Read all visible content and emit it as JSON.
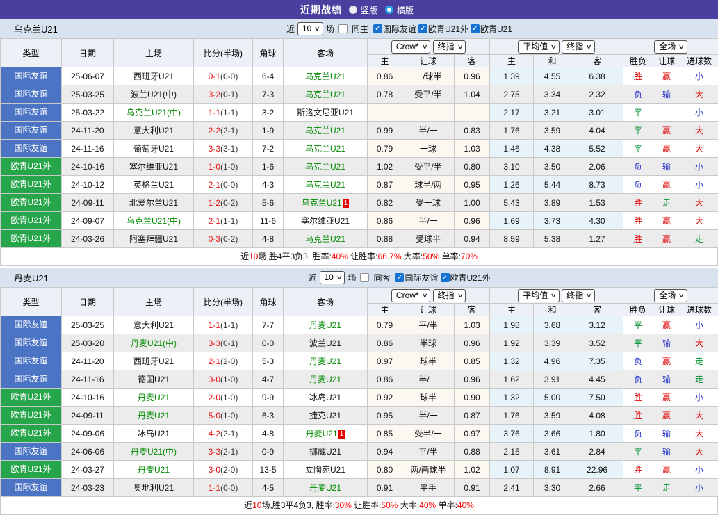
{
  "header": {
    "title": "近期战绩",
    "vertical_label": "竖版",
    "horizontal_label": "横版"
  },
  "table_header": {
    "col_type": "类型",
    "col_date": "日期",
    "col_home": "主场",
    "col_score": "比分(半场)",
    "col_corner": "角球",
    "col_away": "客场",
    "dd_crow": "Crow*",
    "dd_final1": "终指",
    "dd_avg": "平均值",
    "dd_final2": "终指",
    "dd_scope": "全场",
    "sub_home": "主",
    "sub_handicap": "让球",
    "sub_away": "客",
    "sub_avg_home": "主",
    "sub_avg_draw": "和",
    "sub_avg_away": "客",
    "col_result": "胜负",
    "col_handicap_result": "让球",
    "col_goals": "进球数"
  },
  "sections": [
    {
      "team": "乌克兰U21",
      "filter": {
        "near": "近",
        "count": "10",
        "games": "场",
        "same": "同主",
        "checks": [
          "国际友谊",
          "欧青U21外",
          "欧青U21"
        ]
      },
      "rows": [
        {
          "type": "国际友谊",
          "tc": "blue",
          "date": "25-06-07",
          "home": "西班牙U21",
          "hg": false,
          "score": "0-1",
          "half": "(0-0)",
          "corner": "6-4",
          "away": "乌克兰U21",
          "ag": true,
          "card": "",
          "oh": "0.86",
          "hcp": "一/球半",
          "oa": "0.96",
          "ah": "1.39",
          "ad": "4.55",
          "aa": "6.38",
          "res": "胜",
          "resc": "r",
          "hr": "赢",
          "hrc": "r",
          "gl": "小",
          "glc": "b"
        },
        {
          "type": "国际友谊",
          "tc": "blue",
          "date": "25-03-25",
          "home": "波兰U21(中)",
          "hg": false,
          "score": "3-2",
          "half": "(0-1)",
          "corner": "7-3",
          "away": "乌克兰U21",
          "ag": true,
          "card": "",
          "oh": "0.78",
          "hcp": "受平/半",
          "oa": "1.04",
          "ah": "2.75",
          "ad": "3.34",
          "aa": "2.32",
          "res": "负",
          "resc": "b",
          "hr": "输",
          "hrc": "b",
          "gl": "大",
          "glc": "r"
        },
        {
          "type": "国际友谊",
          "tc": "blue",
          "date": "25-03-22",
          "home": "乌克兰U21(中)",
          "hg": true,
          "score": "1-1",
          "half": "(1-1)",
          "corner": "3-2",
          "away": "斯洛文尼亚U21",
          "ag": false,
          "card": "",
          "oh": "",
          "hcp": "",
          "oa": "",
          "ah": "2.17",
          "ad": "3.21",
          "aa": "3.01",
          "res": "平",
          "resc": "g",
          "hr": "",
          "hrc": "",
          "gl": "小",
          "glc": "b"
        },
        {
          "type": "国际友谊",
          "tc": "blue",
          "date": "24-11-20",
          "home": "意大利U21",
          "hg": false,
          "score": "2-2",
          "half": "(2-1)",
          "corner": "1-9",
          "away": "乌克兰U21",
          "ag": true,
          "card": "",
          "oh": "0.99",
          "hcp": "半/一",
          "oa": "0.83",
          "ah": "1.76",
          "ad": "3.59",
          "aa": "4.04",
          "res": "平",
          "resc": "g",
          "hr": "赢",
          "hrc": "r",
          "gl": "大",
          "glc": "r"
        },
        {
          "type": "国际友谊",
          "tc": "blue",
          "date": "24-11-16",
          "home": "葡萄牙U21",
          "hg": false,
          "score": "3-3",
          "half": "(3-1)",
          "corner": "7-2",
          "away": "乌克兰U21",
          "ag": true,
          "card": "",
          "oh": "0.79",
          "hcp": "一球",
          "oa": "1.03",
          "ah": "1.46",
          "ad": "4.38",
          "aa": "5.52",
          "res": "平",
          "resc": "g",
          "hr": "赢",
          "hrc": "r",
          "gl": "大",
          "glc": "r"
        },
        {
          "type": "欧青U21外",
          "tc": "green",
          "date": "24-10-16",
          "home": "塞尔维亚U21",
          "hg": false,
          "score": "1-0",
          "half": "(1-0)",
          "corner": "1-6",
          "away": "乌克兰U21",
          "ag": true,
          "card": "",
          "oh": "1.02",
          "hcp": "受平/半",
          "oa": "0.80",
          "ah": "3.10",
          "ad": "3.50",
          "aa": "2.06",
          "res": "负",
          "resc": "b",
          "hr": "输",
          "hrc": "b",
          "gl": "小",
          "glc": "b"
        },
        {
          "type": "欧青U21外",
          "tc": "green",
          "date": "24-10-12",
          "home": "英格兰U21",
          "hg": false,
          "score": "2-1",
          "half": "(0-0)",
          "corner": "4-3",
          "away": "乌克兰U21",
          "ag": true,
          "card": "",
          "oh": "0.87",
          "hcp": "球半/两",
          "oa": "0.95",
          "ah": "1.26",
          "ad": "5.44",
          "aa": "8.73",
          "res": "负",
          "resc": "b",
          "hr": "赢",
          "hrc": "r",
          "gl": "小",
          "glc": "b"
        },
        {
          "type": "欧青U21外",
          "tc": "green",
          "date": "24-09-11",
          "home": "北爱尔兰U21",
          "hg": false,
          "score": "1-2",
          "half": "(0-2)",
          "corner": "5-6",
          "away": "乌克兰U21",
          "ag": true,
          "card": "1",
          "oh": "0.82",
          "hcp": "受一球",
          "oa": "1.00",
          "ah": "5.43",
          "ad": "3.89",
          "aa": "1.53",
          "res": "胜",
          "resc": "r",
          "hr": "走",
          "hrc": "g",
          "gl": "大",
          "glc": "r"
        },
        {
          "type": "欧青U21外",
          "tc": "green",
          "date": "24-09-07",
          "home": "乌克兰U21(中)",
          "hg": true,
          "score": "2-1",
          "half": "(1-1)",
          "corner": "11-6",
          "away": "塞尔维亚U21",
          "ag": false,
          "card": "",
          "oh": "0.86",
          "hcp": "半/一",
          "oa": "0.96",
          "ah": "1.69",
          "ad": "3.73",
          "aa": "4.30",
          "res": "胜",
          "resc": "r",
          "hr": "赢",
          "hrc": "r",
          "gl": "大",
          "glc": "r"
        },
        {
          "type": "欧青U21外",
          "tc": "green",
          "date": "24-03-26",
          "home": "阿塞拜疆U21",
          "hg": false,
          "score": "0-3",
          "half": "(0-2)",
          "corner": "4-8",
          "away": "乌克兰U21",
          "ag": true,
          "card": "",
          "oh": "0.88",
          "hcp": "受球半",
          "oa": "0.94",
          "ah": "8.59",
          "ad": "5.38",
          "aa": "1.27",
          "res": "胜",
          "resc": "r",
          "hr": "赢",
          "hrc": "r",
          "gl": "走",
          "glc": "g"
        }
      ],
      "summary": [
        {
          "t": "近"
        },
        {
          "t": "10",
          "r": true
        },
        {
          "t": "场,胜4平3负3, 胜率:"
        },
        {
          "t": "40%",
          "r": true
        },
        {
          "t": " 让胜率:"
        },
        {
          "t": "66.7%",
          "r": true
        },
        {
          "t": " 大率:"
        },
        {
          "t": "50%",
          "r": true
        },
        {
          "t": " 单率:"
        },
        {
          "t": "70%",
          "r": true
        }
      ]
    },
    {
      "team": "丹麦U21",
      "filter": {
        "near": "近",
        "count": "10",
        "games": "场",
        "same": "同客",
        "checks": [
          "国际友谊",
          "欧青U21外"
        ]
      },
      "rows": [
        {
          "type": "国际友谊",
          "tc": "blue",
          "date": "25-03-25",
          "home": "意大利U21",
          "hg": false,
          "score": "1-1",
          "half": "(1-1)",
          "corner": "7-7",
          "away": "丹麦U21",
          "ag": true,
          "card": "",
          "oh": "0.79",
          "hcp": "平/半",
          "oa": "1.03",
          "ah": "1.98",
          "ad": "3.68",
          "aa": "3.12",
          "res": "平",
          "resc": "g",
          "hr": "赢",
          "hrc": "r",
          "gl": "小",
          "glc": "b"
        },
        {
          "type": "国际友谊",
          "tc": "blue",
          "date": "25-03-20",
          "home": "丹麦U21(中)",
          "hg": true,
          "score": "3-3",
          "half": "(0-1)",
          "corner": "0-0",
          "away": "波兰U21",
          "ag": false,
          "card": "",
          "oh": "0.86",
          "hcp": "半球",
          "oa": "0.96",
          "ah": "1.92",
          "ad": "3.39",
          "aa": "3.52",
          "res": "平",
          "resc": "g",
          "hr": "输",
          "hrc": "b",
          "gl": "大",
          "glc": "r"
        },
        {
          "type": "国际友谊",
          "tc": "blue",
          "date": "24-11-20",
          "home": "西班牙U21",
          "hg": false,
          "score": "2-1",
          "half": "(2-0)",
          "corner": "5-3",
          "away": "丹麦U21",
          "ag": true,
          "card": "",
          "oh": "0.97",
          "hcp": "球半",
          "oa": "0.85",
          "ah": "1.32",
          "ad": "4.96",
          "aa": "7.35",
          "res": "负",
          "resc": "b",
          "hr": "赢",
          "hrc": "r",
          "gl": "走",
          "glc": "g"
        },
        {
          "type": "国际友谊",
          "tc": "blue",
          "date": "24-11-16",
          "home": "德国U21",
          "hg": false,
          "score": "3-0",
          "half": "(1-0)",
          "corner": "4-7",
          "away": "丹麦U21",
          "ag": true,
          "card": "",
          "oh": "0.86",
          "hcp": "半/一",
          "oa": "0.96",
          "ah": "1.62",
          "ad": "3.91",
          "aa": "4.45",
          "res": "负",
          "resc": "b",
          "hr": "输",
          "hrc": "b",
          "gl": "走",
          "glc": "g"
        },
        {
          "type": "欧青U21外",
          "tc": "green",
          "date": "24-10-16",
          "home": "丹麦U21",
          "hg": true,
          "score": "2-0",
          "half": "(1-0)",
          "corner": "9-9",
          "away": "冰岛U21",
          "ag": false,
          "card": "",
          "oh": "0.92",
          "hcp": "球半",
          "oa": "0.90",
          "ah": "1.32",
          "ad": "5.00",
          "aa": "7.50",
          "res": "胜",
          "resc": "r",
          "hr": "赢",
          "hrc": "r",
          "gl": "小",
          "glc": "b"
        },
        {
          "type": "欧青U21外",
          "tc": "green",
          "date": "24-09-11",
          "home": "丹麦U21",
          "hg": true,
          "score": "5-0",
          "half": "(1-0)",
          "corner": "6-3",
          "away": "捷克U21",
          "ag": false,
          "card": "",
          "oh": "0.95",
          "hcp": "半/一",
          "oa": "0.87",
          "ah": "1.76",
          "ad": "3.59",
          "aa": "4.08",
          "res": "胜",
          "resc": "r",
          "hr": "赢",
          "hrc": "r",
          "gl": "大",
          "glc": "r"
        },
        {
          "type": "欧青U21外",
          "tc": "green",
          "date": "24-09-06",
          "home": "冰岛U21",
          "hg": false,
          "score": "4-2",
          "half": "(2-1)",
          "corner": "4-8",
          "away": "丹麦U21",
          "ag": true,
          "card": "1",
          "oh": "0.85",
          "hcp": "受半/一",
          "oa": "0.97",
          "ah": "3.76",
          "ad": "3.66",
          "aa": "1.80",
          "res": "负",
          "resc": "b",
          "hr": "输",
          "hrc": "b",
          "gl": "大",
          "glc": "r"
        },
        {
          "type": "国际友谊",
          "tc": "blue",
          "date": "24-06-06",
          "home": "丹麦U21(中)",
          "hg": true,
          "score": "3-3",
          "half": "(2-1)",
          "corner": "0-9",
          "away": "挪威U21",
          "ag": false,
          "card": "",
          "oh": "0.94",
          "hcp": "平/半",
          "oa": "0.88",
          "ah": "2.15",
          "ad": "3.61",
          "aa": "2.84",
          "res": "平",
          "resc": "g",
          "hr": "输",
          "hrc": "b",
          "gl": "大",
          "glc": "r"
        },
        {
          "type": "欧青U21外",
          "tc": "green",
          "date": "24-03-27",
          "home": "丹麦U21",
          "hg": true,
          "score": "3-0",
          "half": "(2-0)",
          "corner": "13-5",
          "away": "立陶宛U21",
          "ag": false,
          "card": "",
          "oh": "0.80",
          "hcp": "两/两球半",
          "oa": "1.02",
          "ah": "1.07",
          "ad": "8.91",
          "aa": "22.96",
          "res": "胜",
          "resc": "r",
          "hr": "赢",
          "hrc": "r",
          "gl": "小",
          "glc": "b"
        },
        {
          "type": "国际友谊",
          "tc": "blue",
          "date": "24-03-23",
          "home": "奥地利U21",
          "hg": false,
          "score": "1-1",
          "half": "(0-0)",
          "corner": "4-5",
          "away": "丹麦U21",
          "ag": true,
          "card": "",
          "oh": "0.91",
          "hcp": "平手",
          "oa": "0.91",
          "ah": "2.41",
          "ad": "3.30",
          "aa": "2.66",
          "res": "平",
          "resc": "g",
          "hr": "走",
          "hrc": "g",
          "gl": "小",
          "glc": "b"
        }
      ],
      "summary": [
        {
          "t": "近"
        },
        {
          "t": "10",
          "r": true
        },
        {
          "t": "场,胜3平4负3, 胜率:"
        },
        {
          "t": "30%",
          "r": true
        },
        {
          "t": " 让胜率:"
        },
        {
          "t": "50%",
          "r": true
        },
        {
          "t": " 大率:"
        },
        {
          "t": "40%",
          "r": true
        },
        {
          "t": " 单率:"
        },
        {
          "t": "40%",
          "r": true
        }
      ]
    }
  ]
}
